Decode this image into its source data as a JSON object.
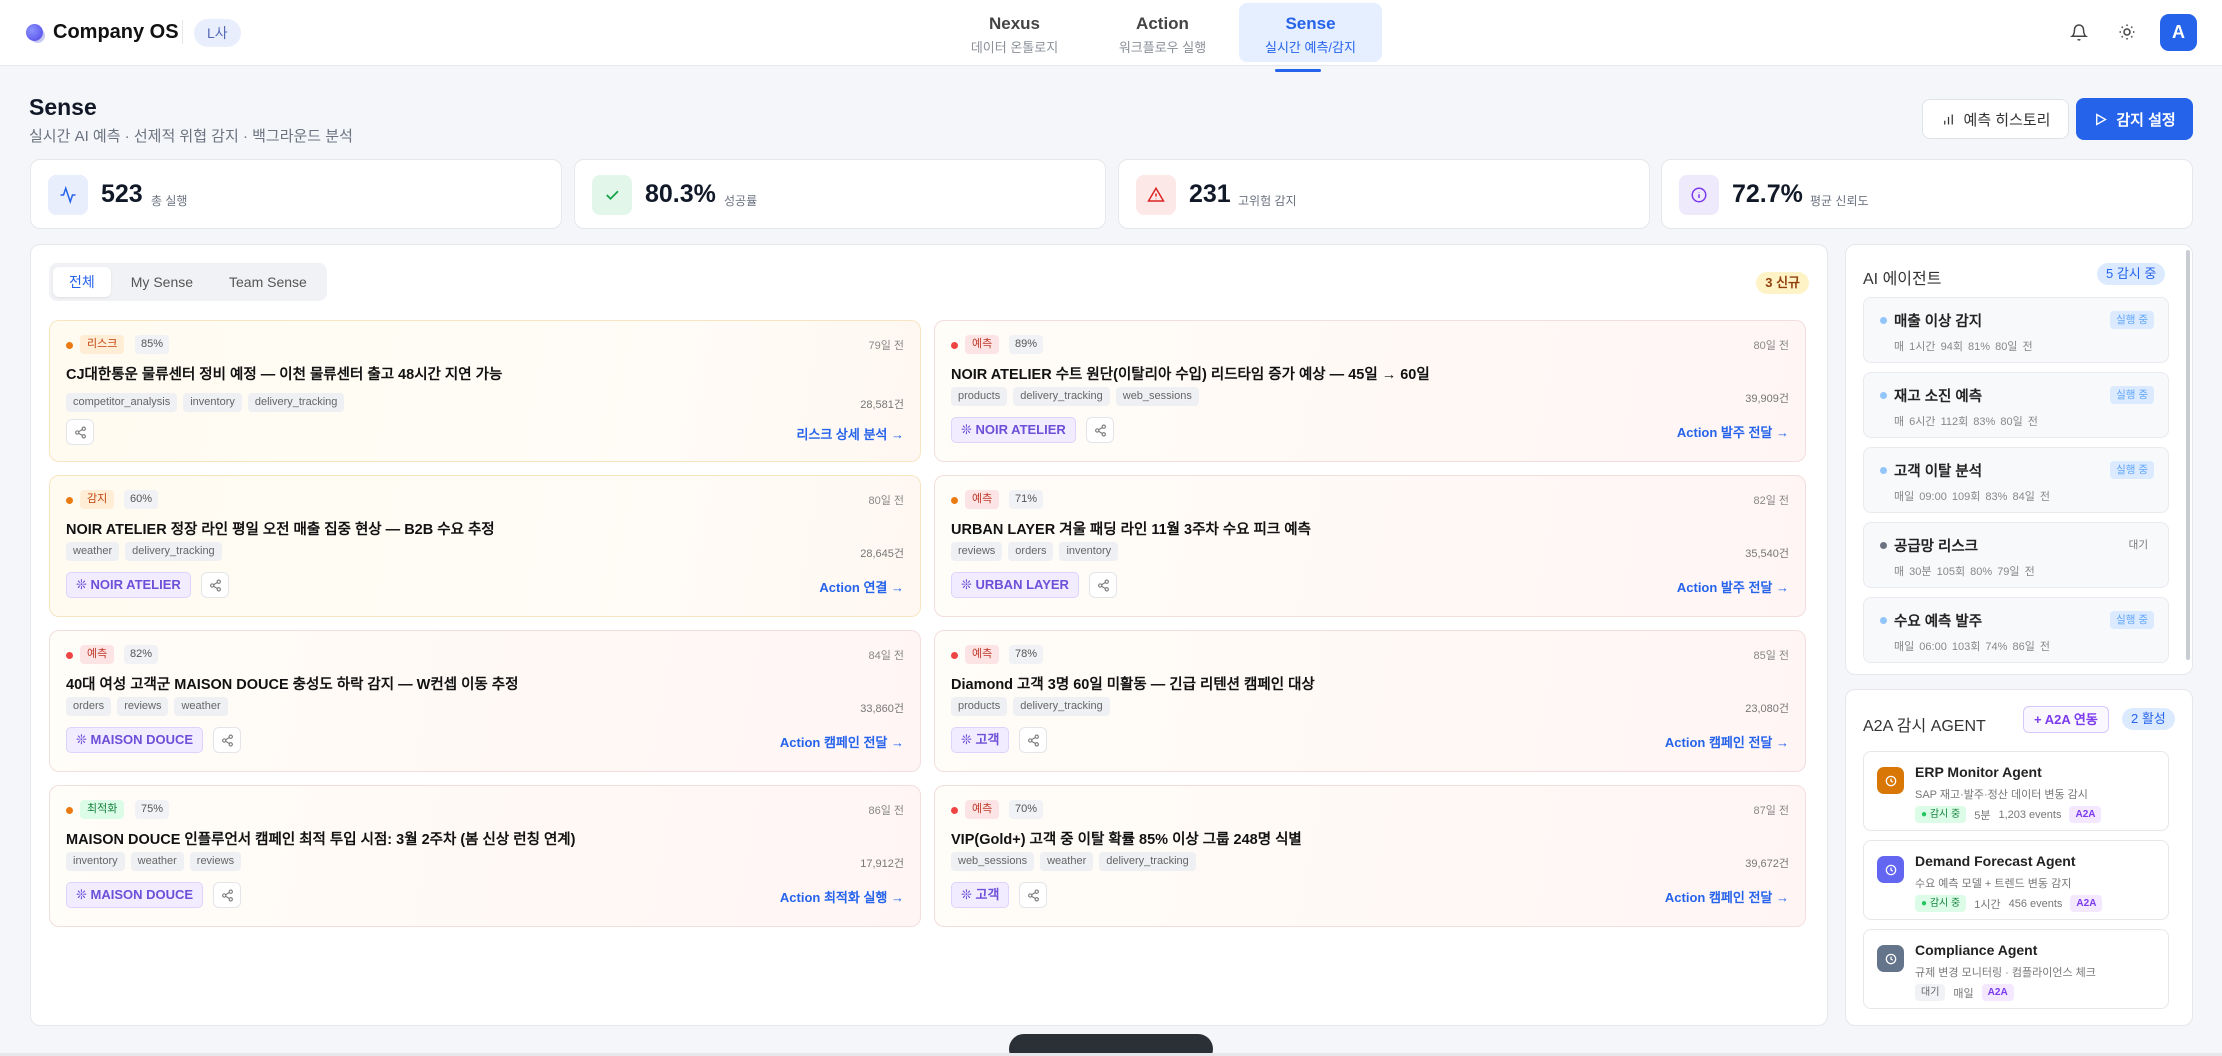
{
  "app": {
    "name": "Company OS",
    "org": "L사",
    "avatar": "A"
  },
  "nav": {
    "tabs": [
      {
        "title": "Nexus",
        "sub": "데이터 온톨로지"
      },
      {
        "title": "Action",
        "sub": "워크플로우 실행"
      },
      {
        "title": "Sense",
        "sub": "실시간 예측/감지"
      }
    ],
    "active": "Sense"
  },
  "page": {
    "title": "Sense",
    "subtitle": "실시간 AI 예측 · 선제적 위협 감지 · 백그라운드 분석",
    "history_btn": "예측 히스토리",
    "settings_btn": "감지 설정"
  },
  "stats": [
    {
      "value": "523",
      "label": "총 실행",
      "icon": "activity-icon"
    },
    {
      "value": "80.3%",
      "label": "성공률",
      "icon": "check-icon"
    },
    {
      "value": "231",
      "label": "고위험 감지",
      "icon": "alert-triangle-icon"
    },
    {
      "value": "72.7%",
      "label": "평균 신뢰도",
      "icon": "info-icon"
    }
  ],
  "filters": {
    "tabs": [
      "전체",
      "My Sense",
      "Team Sense"
    ],
    "active": "전체",
    "new_badge": "3 신규"
  },
  "cards": [
    {
      "tag": "리스크",
      "pct": "85%",
      "age": "79일 전",
      "title": "CJ대한통운 물류센터 정비 예정 — 이천 물류센터 출고 48시간 지연 가능",
      "chips": [
        "competitor_analysis",
        "inventory",
        "delivery_tracking"
      ],
      "count": "28,581건",
      "brand": "",
      "action": "리스크 상세 분석 →"
    },
    {
      "tag": "예측",
      "pct": "89%",
      "age": "80일 전",
      "title": "NOIR ATELIER 수트 원단(이탈리아 수입) 리드타임 증가 예상 — 45일 → 60일",
      "chips": [
        "products",
        "delivery_tracking",
        "web_sessions"
      ],
      "count": "39,909건",
      "brand": "NOIR ATELIER",
      "action": "Action 발주 전달 →"
    },
    {
      "tag": "감지",
      "pct": "60%",
      "age": "80일 전",
      "title": "NOIR ATELIER 정장 라인 평일 오전 매출 집중 현상 — B2B 수요 추정",
      "chips": [
        "weather",
        "delivery_tracking"
      ],
      "count": "28,645건",
      "brand": "NOIR ATELIER",
      "action": "Action 연결 →"
    },
    {
      "tag": "예측",
      "pct": "71%",
      "age": "82일 전",
      "title": "URBAN LAYER 겨울 패딩 라인 11월 3주차 수요 피크 예측",
      "chips": [
        "reviews",
        "orders",
        "inventory"
      ],
      "count": "35,540건",
      "brand": "URBAN LAYER",
      "action": "Action 발주 전달 →"
    },
    {
      "tag": "예측",
      "pct": "82%",
      "age": "84일 전",
      "title": "40대 여성 고객군 MAISON DOUCE 충성도 하락 감지 — W컨셉 이동 추정",
      "chips": [
        "orders",
        "reviews",
        "weather"
      ],
      "count": "33,860건",
      "brand": "MAISON DOUCE",
      "action": "Action 캠페인 전달 →"
    },
    {
      "tag": "예측",
      "pct": "78%",
      "age": "85일 전",
      "title": "Diamond 고객 3명 60일 미활동 — 긴급 리텐션 캠페인 대상",
      "chips": [
        "products",
        "delivery_tracking"
      ],
      "count": "23,080건",
      "brand": "고객",
      "action": "Action 캠페인 전달 →"
    },
    {
      "tag": "최적화",
      "pct": "75%",
      "age": "86일 전",
      "title": "MAISON DOUCE 인플루언서 캠페인 최적 투입 시점: 3월 2주차 (봄 신상 런칭 연계)",
      "chips": [
        "inventory",
        "weather",
        "reviews"
      ],
      "count": "17,912건",
      "brand": "MAISON DOUCE",
      "action": "Action 최적화 실행 →"
    },
    {
      "tag": "예측",
      "pct": "70%",
      "age": "87일 전",
      "title": "VIP(Gold+) 고객 중 이탈 확률 85% 이상 그룹 248명 식별",
      "chips": [
        "web_sessions",
        "weather",
        "delivery_tracking"
      ],
      "count": "39,672건",
      "brand": "고객",
      "action": "Action 캠페인 전달 →"
    }
  ],
  "ai_agents": {
    "title": "AI 에이전트",
    "badge": "5 감시 중",
    "items": [
      {
        "name": "매출 이상 감지",
        "meta": "매 1시간 94회 81% 80일 전",
        "status": "실행 중"
      },
      {
        "name": "재고 소진 예측",
        "meta": "매 6시간 112회 83% 80일 전",
        "status": "실행 중"
      },
      {
        "name": "고객 이탈 분석",
        "meta": "매일 09:00 109회 83% 84일 전",
        "status": "실행 중"
      },
      {
        "name": "공급망 리스크",
        "meta": "매 30분 105회 80% 79일 전",
        "status": "대기"
      },
      {
        "name": "수요 예측 발주",
        "meta": "매일 06:00 103회 74% 86일 전",
        "status": "실행 중"
      }
    ]
  },
  "a2a": {
    "title": "A2A 감시 AGENT",
    "add_btn": "A2A 연동",
    "badge": "2 활성",
    "items": [
      {
        "name": "ERP Monitor Agent",
        "desc": "SAP 재고·발주·정산 데이터 변동 감시",
        "status": "감시 중",
        "interval": "5분",
        "events": "1,203 events",
        "tag": "A2A",
        "color": "#d97706"
      },
      {
        "name": "Demand Forecast Agent",
        "desc": "수요 예측 모델 + 트렌드 변동 감지",
        "status": "감시 중",
        "interval": "1시간",
        "events": "456 events",
        "tag": "A2A",
        "color": "#6366f1"
      },
      {
        "name": "Compliance Agent",
        "desc": "규제 변경 모니터링 · 컴플라이언스 체크",
        "status": "대기",
        "interval": "매일",
        "events": "",
        "tag": "A2A",
        "color": "#64748b"
      }
    ]
  }
}
